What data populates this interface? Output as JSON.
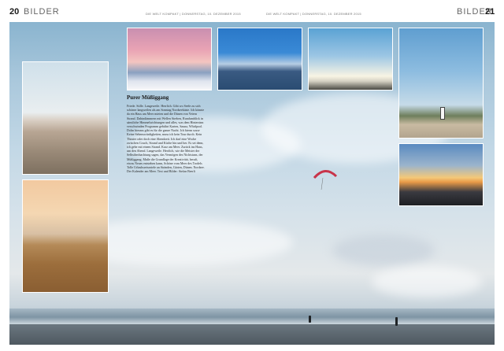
{
  "header": {
    "left_page_number": "20",
    "left_section": "BILDER",
    "left_running_head": "DIE WELT KOMPAKT  |  DONNERSTAG, 10. DEZEMBER 2015",
    "right_running_head": "DIE WELT KOMPAKT  |  DONNERSTAG, 10. DEZEMBER 2015",
    "right_section": "BILDER",
    "right_page_number": "21"
  },
  "article": {
    "title": "Purer Müßiggang",
    "body": "Friede. Stille. Langeweile. Herrlich. Gibt wo Seele zu sich schöner langweilen als am Sonntag Nordseeküste. Ich könnte da ein Haus am Meer mieten und die Dünen von Veiern Strand. Dahindämmern mit Wellen Streben, Rundumblick in sämtliche Himmelsrichtungen und alles, was dem Hintersinn verschwinden Programm gebührt Karten, Sauna, Whirlpool. Dolm hieraus gibt es für die ganze Nacht. Ich hierm sosse Keine Sehenswürdigkeiten, muss ich kein Tour durch. Kein Theater oder doch eine Abendzeit. Ich darf eine Woche zwischen Couch, Strand und Küche hin und her. Es sei denn, ich gehe mit einem Strand. Kurz am Meer. Zurück ins Haus, um den Abend. Langeweile. Herrlich, wie die Meister der Selbstbeobachtung sagen, das Vermögen des Nichtstuns, der Müßiggang. Muße die Grundlage der Kreativität, beruft, etwas Neues entstehen kann, Schöne vom Meer des Trodels Tolle Urlaubsreiseziele an Stränden, Gärten, Dünen. Nordsee. Der Kalender am Meer. Text und Bilder: Stefan Beerli"
  },
  "photos": [
    {
      "name": "dune-beach-photo"
    },
    {
      "name": "dune-path-photo"
    },
    {
      "name": "pink-sunset-photo"
    },
    {
      "name": "rocky-shore-photo"
    },
    {
      "name": "birds-sun-photo"
    },
    {
      "name": "lighthouse-photo"
    },
    {
      "name": "kitesurfer-sunset-photo"
    }
  ],
  "colors": {
    "sky_top": "#8ab4cf",
    "sky_bottom": "#e4e8ea",
    "kite": "#c8344a",
    "page_bg": "#ffffff"
  }
}
